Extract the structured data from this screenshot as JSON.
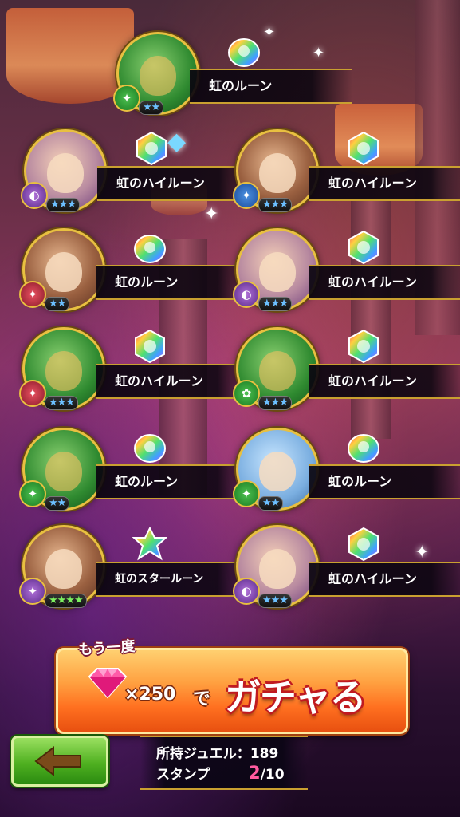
{
  "results": [
    {
      "name": "虹のルーン",
      "stars": "★★",
      "badge": "✦",
      "badge_color": "green",
      "portrait": "green",
      "rune": "rainbow-rune"
    },
    {
      "name": "虹のハイルーン",
      "stars": "★★★",
      "badge": "◐",
      "badge_color": "purple",
      "portrait": "purple",
      "rune": "rainbow-high-rune"
    },
    {
      "name": "虹のハイルーン",
      "stars": "★★★",
      "badge": "✦",
      "badge_color": "blue",
      "portrait": "brown",
      "rune": "rainbow-high-rune"
    },
    {
      "name": "虹のルーン",
      "stars": "★★",
      "badge": "✦",
      "badge_color": "red",
      "portrait": "brown",
      "rune": "rainbow-rune"
    },
    {
      "name": "虹のハイルーン",
      "stars": "★★★",
      "badge": "◐",
      "badge_color": "purple",
      "portrait": "purple",
      "rune": "rainbow-high-rune"
    },
    {
      "name": "虹のハイルーン",
      "stars": "★★★",
      "badge": "✦",
      "badge_color": "red",
      "portrait": "green",
      "rune": "rainbow-high-rune"
    },
    {
      "name": "虹のハイルーン",
      "stars": "★★★",
      "badge": "✿",
      "badge_color": "green",
      "portrait": "green",
      "rune": "rainbow-high-rune"
    },
    {
      "name": "虹のルーン",
      "stars": "★★",
      "badge": "✦",
      "badge_color": "green",
      "portrait": "green",
      "rune": "rainbow-rune"
    },
    {
      "name": "虹のルーン",
      "stars": "★★",
      "badge": "✦",
      "badge_color": "green",
      "portrait": "blue",
      "rune": "rainbow-rune"
    },
    {
      "name": "虹のスタールーン",
      "stars": "★★★★",
      "badge": "✦",
      "badge_color": "purple",
      "portrait": "brown",
      "rune": "rainbow-star-rune"
    },
    {
      "name": "虹のハイルーン",
      "stars": "★★★",
      "badge": "◐",
      "badge_color": "purple",
      "portrait": "purple",
      "rune": "rainbow-high-rune"
    }
  ],
  "gacha": {
    "tag": "もう一度",
    "cost": "×250",
    "de": "で",
    "label": "ガチャる"
  },
  "back_button": {
    "icon": "back-arrow-icon"
  },
  "info": {
    "jewels_label": "所持ジュエル：",
    "jewels_value": "189",
    "stamp_label": "スタンプ",
    "stamp_current": "2",
    "stamp_total": "/10"
  },
  "colors": {
    "gold": "#c9a030",
    "gacha_orange": "#ff7020",
    "back_green": "#4fb020",
    "stamp_pink": "#ff5aa0"
  }
}
